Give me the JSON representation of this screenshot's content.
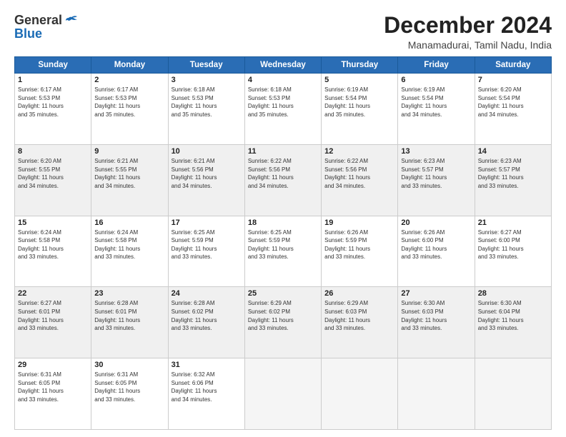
{
  "header": {
    "logo_general": "General",
    "logo_blue": "Blue",
    "title": "December 2024",
    "location": "Manamadurai, Tamil Nadu, India"
  },
  "days_of_week": [
    "Sunday",
    "Monday",
    "Tuesday",
    "Wednesday",
    "Thursday",
    "Friday",
    "Saturday"
  ],
  "weeks": [
    [
      {
        "day": "1",
        "info": "Sunrise: 6:17 AM\nSunset: 5:53 PM\nDaylight: 11 hours\nand 35 minutes."
      },
      {
        "day": "2",
        "info": "Sunrise: 6:17 AM\nSunset: 5:53 PM\nDaylight: 11 hours\nand 35 minutes."
      },
      {
        "day": "3",
        "info": "Sunrise: 6:18 AM\nSunset: 5:53 PM\nDaylight: 11 hours\nand 35 minutes."
      },
      {
        "day": "4",
        "info": "Sunrise: 6:18 AM\nSunset: 5:53 PM\nDaylight: 11 hours\nand 35 minutes."
      },
      {
        "day": "5",
        "info": "Sunrise: 6:19 AM\nSunset: 5:54 PM\nDaylight: 11 hours\nand 35 minutes."
      },
      {
        "day": "6",
        "info": "Sunrise: 6:19 AM\nSunset: 5:54 PM\nDaylight: 11 hours\nand 34 minutes."
      },
      {
        "day": "7",
        "info": "Sunrise: 6:20 AM\nSunset: 5:54 PM\nDaylight: 11 hours\nand 34 minutes."
      }
    ],
    [
      {
        "day": "8",
        "info": "Sunrise: 6:20 AM\nSunset: 5:55 PM\nDaylight: 11 hours\nand 34 minutes."
      },
      {
        "day": "9",
        "info": "Sunrise: 6:21 AM\nSunset: 5:55 PM\nDaylight: 11 hours\nand 34 minutes."
      },
      {
        "day": "10",
        "info": "Sunrise: 6:21 AM\nSunset: 5:56 PM\nDaylight: 11 hours\nand 34 minutes."
      },
      {
        "day": "11",
        "info": "Sunrise: 6:22 AM\nSunset: 5:56 PM\nDaylight: 11 hours\nand 34 minutes."
      },
      {
        "day": "12",
        "info": "Sunrise: 6:22 AM\nSunset: 5:56 PM\nDaylight: 11 hours\nand 34 minutes."
      },
      {
        "day": "13",
        "info": "Sunrise: 6:23 AM\nSunset: 5:57 PM\nDaylight: 11 hours\nand 33 minutes."
      },
      {
        "day": "14",
        "info": "Sunrise: 6:23 AM\nSunset: 5:57 PM\nDaylight: 11 hours\nand 33 minutes."
      }
    ],
    [
      {
        "day": "15",
        "info": "Sunrise: 6:24 AM\nSunset: 5:58 PM\nDaylight: 11 hours\nand 33 minutes."
      },
      {
        "day": "16",
        "info": "Sunrise: 6:24 AM\nSunset: 5:58 PM\nDaylight: 11 hours\nand 33 minutes."
      },
      {
        "day": "17",
        "info": "Sunrise: 6:25 AM\nSunset: 5:59 PM\nDaylight: 11 hours\nand 33 minutes."
      },
      {
        "day": "18",
        "info": "Sunrise: 6:25 AM\nSunset: 5:59 PM\nDaylight: 11 hours\nand 33 minutes."
      },
      {
        "day": "19",
        "info": "Sunrise: 6:26 AM\nSunset: 5:59 PM\nDaylight: 11 hours\nand 33 minutes."
      },
      {
        "day": "20",
        "info": "Sunrise: 6:26 AM\nSunset: 6:00 PM\nDaylight: 11 hours\nand 33 minutes."
      },
      {
        "day": "21",
        "info": "Sunrise: 6:27 AM\nSunset: 6:00 PM\nDaylight: 11 hours\nand 33 minutes."
      }
    ],
    [
      {
        "day": "22",
        "info": "Sunrise: 6:27 AM\nSunset: 6:01 PM\nDaylight: 11 hours\nand 33 minutes."
      },
      {
        "day": "23",
        "info": "Sunrise: 6:28 AM\nSunset: 6:01 PM\nDaylight: 11 hours\nand 33 minutes."
      },
      {
        "day": "24",
        "info": "Sunrise: 6:28 AM\nSunset: 6:02 PM\nDaylight: 11 hours\nand 33 minutes."
      },
      {
        "day": "25",
        "info": "Sunrise: 6:29 AM\nSunset: 6:02 PM\nDaylight: 11 hours\nand 33 minutes."
      },
      {
        "day": "26",
        "info": "Sunrise: 6:29 AM\nSunset: 6:03 PM\nDaylight: 11 hours\nand 33 minutes."
      },
      {
        "day": "27",
        "info": "Sunrise: 6:30 AM\nSunset: 6:03 PM\nDaylight: 11 hours\nand 33 minutes."
      },
      {
        "day": "28",
        "info": "Sunrise: 6:30 AM\nSunset: 6:04 PM\nDaylight: 11 hours\nand 33 minutes."
      }
    ],
    [
      {
        "day": "29",
        "info": "Sunrise: 6:31 AM\nSunset: 6:05 PM\nDaylight: 11 hours\nand 33 minutes."
      },
      {
        "day": "30",
        "info": "Sunrise: 6:31 AM\nSunset: 6:05 PM\nDaylight: 11 hours\nand 33 minutes."
      },
      {
        "day": "31",
        "info": "Sunrise: 6:32 AM\nSunset: 6:06 PM\nDaylight: 11 hours\nand 34 minutes."
      },
      {
        "day": "",
        "info": ""
      },
      {
        "day": "",
        "info": ""
      },
      {
        "day": "",
        "info": ""
      },
      {
        "day": "",
        "info": ""
      }
    ]
  ]
}
